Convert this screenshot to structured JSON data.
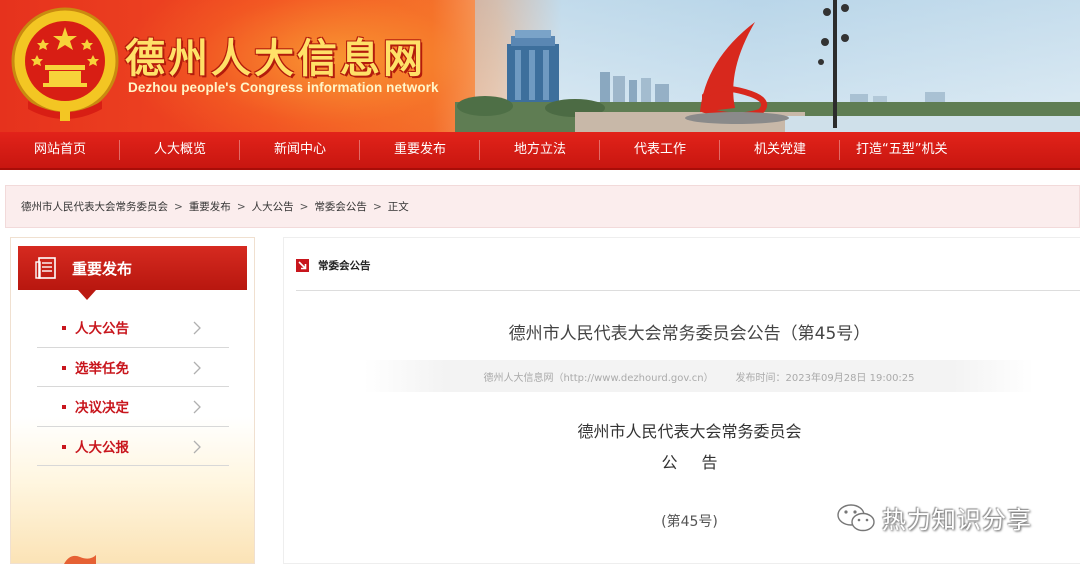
{
  "header": {
    "site_title": "德州人大信息网",
    "site_subtitle": "Dezhou people's Congress information network"
  },
  "nav": {
    "items": [
      "网站首页",
      "人大概览",
      "新闻中心",
      "重要发布",
      "地方立法",
      "代表工作",
      "机关党建",
      "打造“五型”机关"
    ]
  },
  "breadcrumb": {
    "items": [
      "德州市人民代表大会常务委员会",
      "重要发布",
      "人大公告",
      "常委会公告",
      "正文"
    ],
    "separator": ">"
  },
  "sidebar": {
    "heading": "重要发布",
    "items": [
      {
        "label": "人大公告"
      },
      {
        "label": "选举任免"
      },
      {
        "label": "决议决定"
      },
      {
        "label": "人大公报"
      }
    ]
  },
  "article": {
    "category": "常委会公告",
    "title": "德州市人民代表大会常务委员会公告（第45号）",
    "source": "德州人大信息网（http://www.dezhourd.gov.cn）",
    "publish_time": "发布时间：2023年09月28日 19:00:25",
    "body_line1": "德州市人民代表大会常务委员会",
    "body_line2": "公告",
    "body_line3": "(第45号)"
  },
  "watermark": {
    "text": "热力知识分享"
  },
  "colors": {
    "brand_red": "#c8161d",
    "nav_red": "#d41d15",
    "title_yellow": "#ffe168"
  },
  "icons": {
    "emblem": "national-emblem",
    "sidebar_heading": "document-icon",
    "sidebar_chevron": "chevron-right-icon",
    "category": "arrow-down-right-icon",
    "watermark": "wechat-icon"
  }
}
